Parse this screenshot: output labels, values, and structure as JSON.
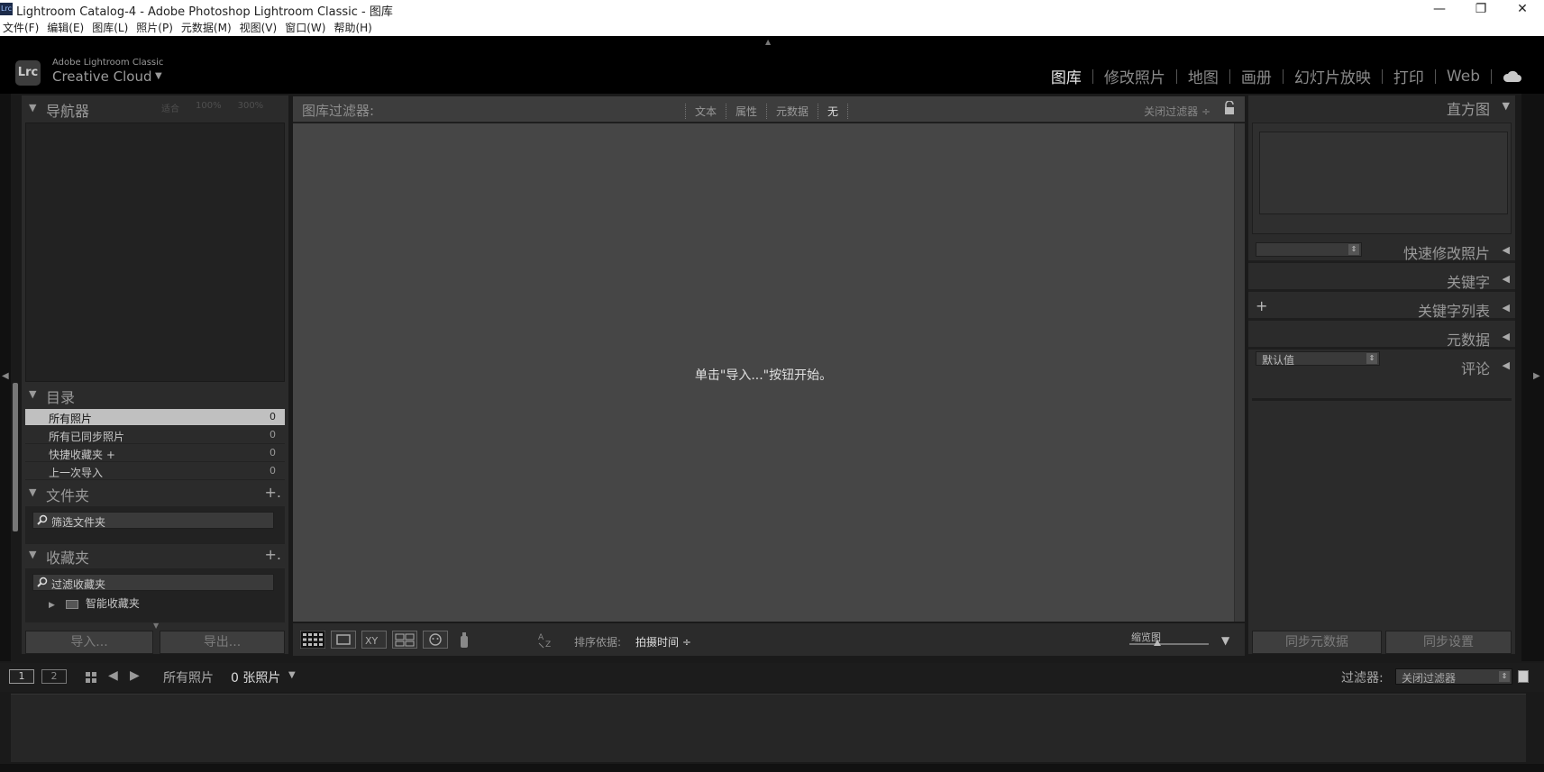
{
  "window": {
    "title": "Lightroom Catalog-4 - Adobe Photoshop Lightroom Classic - 图库",
    "app_badge": "Lrc"
  },
  "menu": [
    "文件(F)",
    "编辑(E)",
    "图库(L)",
    "照片(P)",
    "元数据(M)",
    "视图(V)",
    "窗口(W)",
    "帮助(H)"
  ],
  "brand": {
    "badge": "Lrc",
    "line1": "Adobe Lightroom Classic",
    "line2": "Creative Cloud"
  },
  "modules": [
    {
      "label": "图库",
      "active": true
    },
    {
      "label": "修改照片",
      "active": false
    },
    {
      "label": "地图",
      "active": false
    },
    {
      "label": "画册",
      "active": false
    },
    {
      "label": "幻灯片放映",
      "active": false
    },
    {
      "label": "打印",
      "active": false
    },
    {
      "label": "Web",
      "active": false
    }
  ],
  "left_panel": {
    "navigator": {
      "title": "导航器",
      "options": [
        "适合",
        "100%",
        "300%"
      ]
    },
    "catalog": {
      "title": "目录",
      "rows": [
        {
          "name": "所有照片",
          "count": "0",
          "selected": true
        },
        {
          "name": "所有已同步照片",
          "count": "0",
          "selected": false
        },
        {
          "name": "快捷收藏夹 +",
          "count": "0",
          "selected": false
        },
        {
          "name": "上一次导入",
          "count": "0",
          "selected": false
        }
      ]
    },
    "folders": {
      "title": "文件夹",
      "search_placeholder": "筛选文件夹"
    },
    "collections": {
      "title": "收藏夹",
      "search_placeholder": "过滤收藏夹",
      "smart": "智能收藏夹"
    },
    "import_label": "导入...",
    "export_label": "导出..."
  },
  "filter_bar": {
    "title": "图库过滤器:",
    "tabs": [
      "文本",
      "属性",
      "元数据",
      "无"
    ],
    "close_label": "关闭过滤器 ÷"
  },
  "grid": {
    "empty_message": "单击\"导入...\"按钮开始。"
  },
  "toolbar": {
    "sort_label": "排序依据:",
    "sort_value": "拍摄时间 ÷",
    "thumb_label": "缩览图",
    "thumb_level": 0.35
  },
  "right_panel": {
    "histogram": "直方图",
    "quick_develop": "快速修改照片",
    "keywording": "关键字",
    "keyword_list": "关键字列表",
    "metadata": "元数据",
    "metadata_preset": "默认值",
    "comments": "评论",
    "sync_metadata": "同步元数据",
    "sync_settings": "同步设置"
  },
  "filmstrip": {
    "page1": "1",
    "page2": "2",
    "source": "所有照片",
    "count": "0 张照片",
    "filter_label": "过滤器:",
    "filter_value": "关闭过滤器"
  },
  "colors": {
    "panel": "#2b2b2b",
    "grid": "#464646",
    "active_module": "#e8e8e8"
  }
}
